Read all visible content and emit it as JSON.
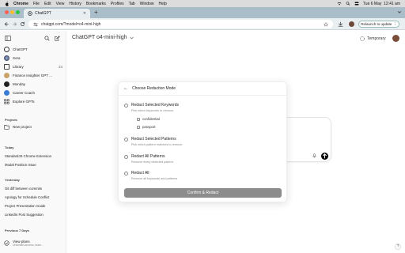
{
  "menubar": {
    "app": "Chrome",
    "items": [
      "File",
      "Edit",
      "View",
      "History",
      "Bookmarks",
      "Profiles",
      "Tab",
      "Window",
      "Help"
    ],
    "datetime": "Tue 6 May  12:41 am"
  },
  "browser": {
    "tab_title": "ChatGPT",
    "url": "chatgpt.com/?model=o4-mini-high",
    "relaunch_label": "Relaunch to update"
  },
  "sidebar": {
    "items": [
      {
        "label": "ChatGPT",
        "icon": "chatgpt-logo-icon"
      },
      {
        "label": "Sora",
        "icon": "sora-icon"
      },
      {
        "label": "Library",
        "icon": "library-icon",
        "badge": "24"
      },
      {
        "label": "Finance Insighter GPT ...",
        "icon": "gpt-avatar-icon"
      },
      {
        "label": "Monday",
        "icon": "monday-icon"
      },
      {
        "label": "Career Coach",
        "icon": "career-coach-icon"
      },
      {
        "label": "Explore GPTs",
        "icon": "explore-grid-icon"
      }
    ],
    "projects_heading": "Projects",
    "new_project": "New project",
    "sections": [
      {
        "heading": "Today",
        "chats": [
          "StandardJS Chrome Extension",
          "Modal Position Issue"
        ]
      },
      {
        "heading": "Yesterday",
        "chats": [
          "Git diff between commits",
          "Apology for Schedule Conflict",
          "Project Presentation Guide",
          "LinkedIn Post Suggestion"
        ]
      },
      {
        "heading": "Previous 7 Days",
        "chats": []
      }
    ],
    "view_plans": "View plans",
    "view_plans_sub": "Unlimited access, team..."
  },
  "main": {
    "model_title": "ChatGPT o4-mini-high",
    "temporary_label": "Temporary"
  },
  "modal": {
    "title": "Choose Redaction Mode",
    "options": [
      {
        "title": "Redact Selected Keywords",
        "desc": "Pick which keywords to remove.",
        "selected": false
      },
      {
        "title": "Redact Selected Patterns",
        "desc": "Pick which pattern matches to remove.",
        "selected": false
      },
      {
        "title": "Redact All Patterns",
        "desc": "Remove every detected pattern.",
        "selected": false
      },
      {
        "title": "Redact All",
        "desc": "Remove all keywords and patterns",
        "selected": false
      }
    ],
    "keywords": [
      {
        "label": "confidential",
        "checked": false
      },
      {
        "label": "passport",
        "checked": false
      }
    ],
    "confirm_label": "Confirm & Redact"
  },
  "help_label": "?"
}
